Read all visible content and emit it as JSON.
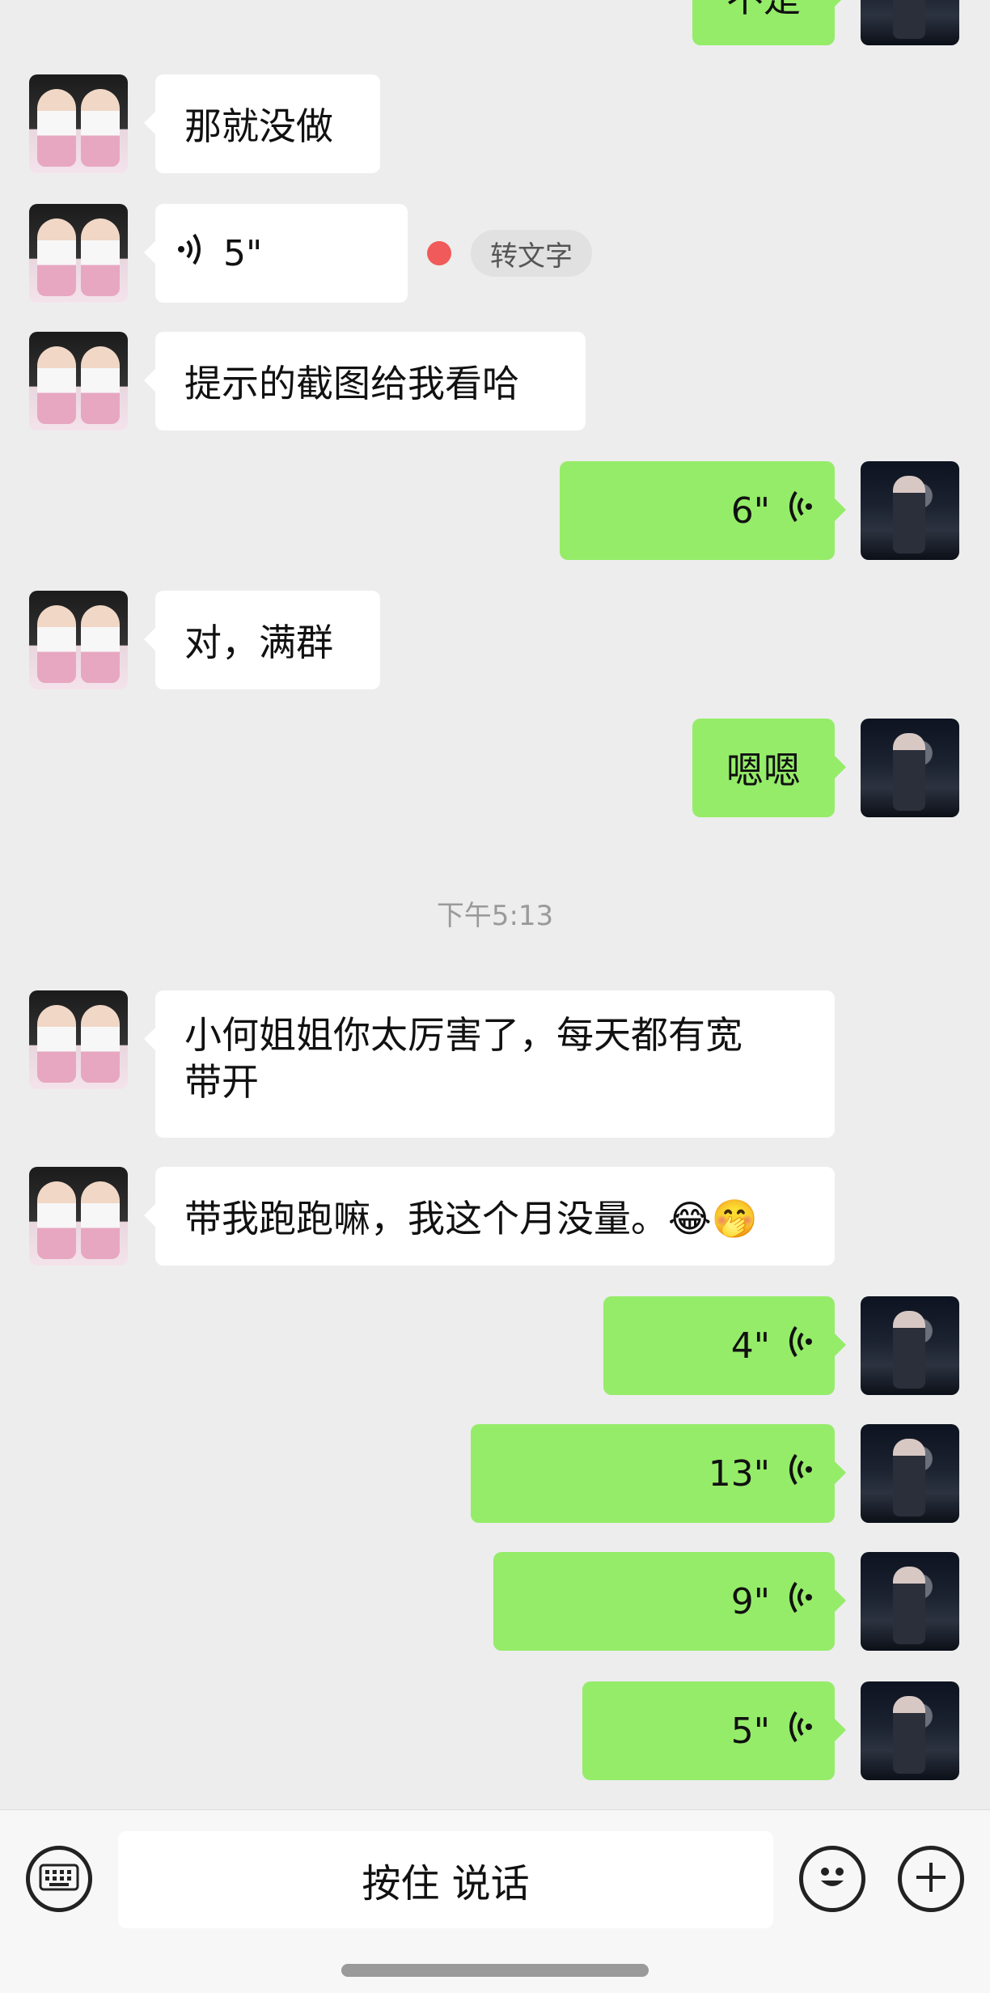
{
  "messages": {
    "m0": {
      "direction": "sent",
      "text": "不是"
    },
    "m1": {
      "direction": "received",
      "text": "那就没做"
    },
    "m2": {
      "direction": "received",
      "type": "voice",
      "duration": "5\"",
      "transcribe_label": "转文字"
    },
    "m3": {
      "direction": "received",
      "text": "提示的截图给我看哈"
    },
    "m4": {
      "direction": "sent",
      "type": "voice",
      "duration": "6\""
    },
    "m5": {
      "direction": "received",
      "text": "对，满群"
    },
    "m6": {
      "direction": "sent",
      "text": "嗯嗯"
    },
    "timestamp": "下午5:13",
    "m7": {
      "direction": "received",
      "line1": "小何姐姐你太厉害了，每天都有宽",
      "line2": "带开"
    },
    "m8": {
      "direction": "received",
      "text": "带我跑跑嘛，我这个月没量。😂🤭"
    },
    "m9": {
      "direction": "sent",
      "type": "voice",
      "duration": "4\""
    },
    "m10": {
      "direction": "sent",
      "type": "voice",
      "duration": "13\""
    },
    "m11": {
      "direction": "sent",
      "type": "voice",
      "duration": "9\""
    },
    "m12": {
      "direction": "sent",
      "type": "voice",
      "duration": "5\""
    }
  },
  "input_bar": {
    "hold_to_talk_label": "按住 说话",
    "left_icon": "keyboard-icon",
    "emoji_icon": "emoji-icon",
    "plus_icon": "plus-icon"
  },
  "colors": {
    "background": "#ededed",
    "sent_bubble": "#95ec69",
    "received_bubble": "#ffffff",
    "unread_dot": "#f05a5a"
  }
}
